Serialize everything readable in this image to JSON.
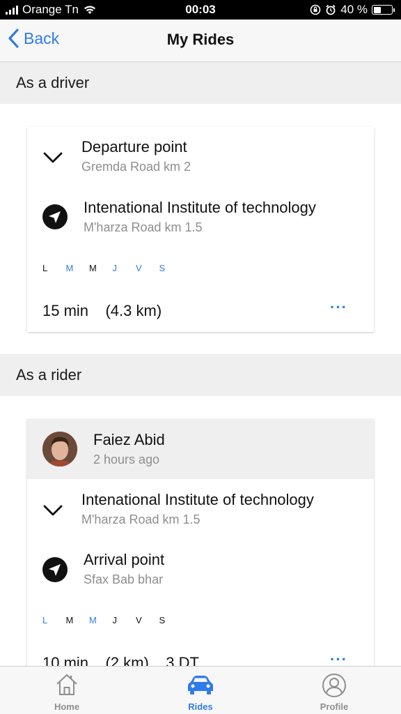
{
  "status_bar": {
    "carrier": "Orange Tn",
    "time": "00:03",
    "battery": "40 %",
    "battery_level": 0.4
  },
  "nav": {
    "back_label": "Back",
    "title": "My Rides"
  },
  "driver_section": {
    "header": "As a driver",
    "card": {
      "departure_title": "Departure point",
      "departure_sub": "Gremda Road km 2",
      "arrival_title": "Intenational Institute of technology",
      "arrival_sub": "M'harza Road km 1.5",
      "days": [
        {
          "label": "L",
          "active": true
        },
        {
          "label": "M",
          "active": false
        },
        {
          "label": "M",
          "active": true
        },
        {
          "label": "J",
          "active": false
        },
        {
          "label": "V",
          "active": false
        },
        {
          "label": "S",
          "active": false
        }
      ],
      "duration": "15 min    (4.3 km)",
      "more": "···"
    }
  },
  "rider_section": {
    "header": "As a rider",
    "card": {
      "name": "Faiez Abid",
      "time_ago": "2 hours ago",
      "departure_title": "Intenational Institute of technology",
      "departure_sub": "M'harza Road km 1.5",
      "arrival_title": "Arrival point",
      "arrival_sub": "Sfax Bab bhar",
      "days": [
        {
          "label": "L",
          "active": false
        },
        {
          "label": "M",
          "active": true
        },
        {
          "label": "M",
          "active": false
        },
        {
          "label": "J",
          "active": true
        },
        {
          "label": "V",
          "active": true
        },
        {
          "label": "S",
          "active": true
        }
      ],
      "duration": "10 min    (2 km)    3 DT",
      "more": "···"
    }
  },
  "tabs": [
    {
      "label": "Home",
      "icon": "home-icon",
      "active": false
    },
    {
      "label": "Rides",
      "icon": "car-icon",
      "active": true
    },
    {
      "label": "Profile",
      "icon": "profile-icon",
      "active": false
    }
  ],
  "colors": {
    "accent": "#2f7bea",
    "inactive": "#8e8e8e",
    "section_bg": "#efefef"
  }
}
